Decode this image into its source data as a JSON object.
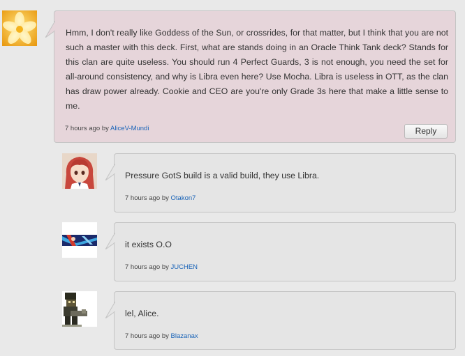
{
  "colors": {
    "page_bg": "#e9e9e9",
    "main_bubble_bg": "#e6d5da",
    "reply_bubble_bg": "#e5e5e5",
    "bubble_border": "#c4c4c4",
    "author_link": "#1a64b8",
    "text": "#333333"
  },
  "main_comment": {
    "avatar_icon": "flower-icon",
    "text": "Hmm, I don't really like Goddess of the Sun, or crossrides, for that matter, but I think that you are not such a master with this deck. First, what are stands doing in an Oracle Think Tank deck? Stands for this clan are quite useless. You should run 4 Perfect Guards, 3 is not enough, you need the set for all-around consistency, and why is Libra even here? Use Mocha. Libra is useless in OTT, as the clan has draw power already. Cookie and CEO are you're only Grade 3s here that make a little sense to me.",
    "time": "7 hours ago",
    "by": "by",
    "author": "AliceV-Mundi",
    "reply_label": "Reply"
  },
  "replies": [
    {
      "avatar_icon": "anime-girl-avatar-icon",
      "text": "Pressure GotS build is a valid build, they use Libra.",
      "time": "7 hours ago",
      "by": "by",
      "author": "Otakon7"
    },
    {
      "avatar_icon": "anime-banner-avatar-icon",
      "text": "it exists O.O",
      "time": "7 hours ago",
      "by": "by",
      "author": "JUCHEN"
    },
    {
      "avatar_icon": "pixel-character-avatar-icon",
      "text": "lel, Alice.",
      "time": "7 hours ago",
      "by": "by",
      "author": "Blazanax"
    }
  ]
}
